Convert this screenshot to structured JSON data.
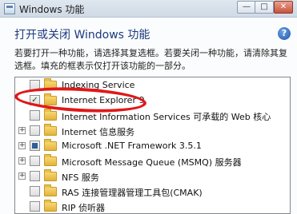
{
  "window": {
    "title": "Windows 功能",
    "buttons": {
      "minimize": "—",
      "maximize": "□",
      "close": "✕"
    }
  },
  "header": {
    "heading": "打开或关闭 Windows 功能",
    "help_icon": "?",
    "description": "若要打开一种功能，请选择其复选框。若要关闭一种功能，请清除其复选框。填充的框表示仅打开该功能的一部分。"
  },
  "features": [
    {
      "label": "Indexing Service",
      "state": "unchecked",
      "expandable": false
    },
    {
      "label": "Internet Explorer 9",
      "state": "checked",
      "expandable": false
    },
    {
      "label": "Internet Information Services 可承载的 Web 核心",
      "state": "unchecked",
      "expandable": false
    },
    {
      "label": "Internet 信息服务",
      "state": "unchecked",
      "expandable": true
    },
    {
      "label": "Microsoft .NET Framework 3.5.1",
      "state": "partial",
      "expandable": true
    },
    {
      "label": "Microsoft Message Queue (MSMQ) 服务器",
      "state": "unchecked",
      "expandable": true
    },
    {
      "label": "NFS 服务",
      "state": "unchecked",
      "expandable": true
    },
    {
      "label": "RAS 连接管理器管理工具包(CMAK)",
      "state": "unchecked",
      "expandable": false
    },
    {
      "label": "RIP 侦听器",
      "state": "unchecked",
      "expandable": false
    }
  ],
  "glyphs": {
    "expander": "+",
    "check": "✓"
  },
  "colors": {
    "annotation": "#e01818",
    "heading": "#1a3a7c",
    "folder": "#e2b33a"
  }
}
